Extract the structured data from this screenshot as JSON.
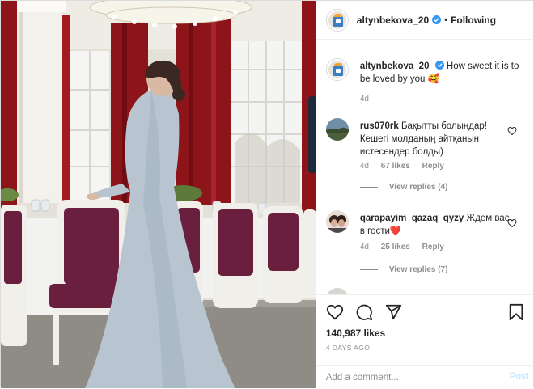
{
  "post": {
    "photo_alt": "",
    "author": {
      "username": "altynbekova_20",
      "verified": true,
      "follow_status": "Following"
    },
    "caption": {
      "username": "altynbekova_20",
      "text": "How sweet it is to be loved by you 🥰",
      "time": "4d"
    },
    "comments": [
      {
        "username": "rus070rk",
        "text": "Бақытты болыңдар! Кешегі молданың айтқанын истесендер болды)",
        "time": "4d",
        "likes": "67 likes",
        "reply_label": "Reply",
        "view_replies": "View replies (4)"
      },
      {
        "username": "qarapayim_qazaq_qyzy",
        "text": "Ждем вас в гости❤️",
        "time": "4d",
        "likes": "25 likes",
        "reply_label": "Reply",
        "view_replies": "View replies (7)"
      }
    ],
    "likes": "140,987 likes",
    "posted_ago": "4 DAYS AGO",
    "comment_input": {
      "placeholder": "Add a comment...",
      "value": ""
    },
    "post_button": "Post"
  },
  "icons": {
    "like": "heart-icon",
    "comment": "comment-icon",
    "share": "paper-plane-icon",
    "save": "bookmark-icon",
    "verified": "verified-badge-icon"
  },
  "colors": {
    "verified_blue": "#3897f0",
    "muted_text": "#8e8e8e",
    "post_button_disabled": "#b2dffc",
    "heart_red": "#e0102a",
    "curtain_red": "#8d1418",
    "chair_purple": "#6a1f3e"
  }
}
